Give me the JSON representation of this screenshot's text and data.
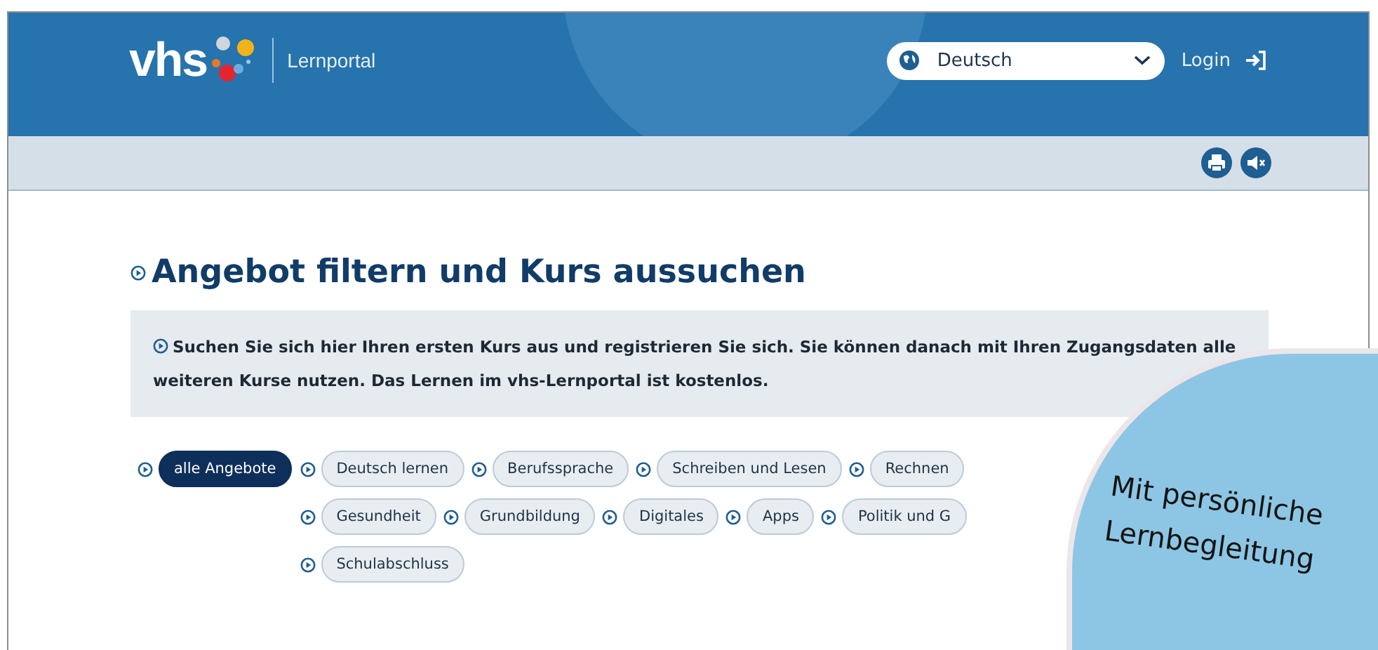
{
  "header": {
    "logo": "vhs",
    "portal_name": "Lernportal",
    "language_select": {
      "value": "Deutsch"
    },
    "login": "Login"
  },
  "heading": "Angebot filtern und Kurs aussuchen",
  "info": "Suchen Sie sich hier Ihren ersten Kurs aus und registrieren Sie sich. Sie können danach mit Ihren Zugangsdaten alle weiteren Kurse nutzen. Das Lernen im vhs-Lernportal ist kostenlos.",
  "filters": [
    {
      "label": "alle Angebote",
      "selected": true
    },
    {
      "label": "Deutsch lernen",
      "selected": false
    },
    {
      "label": "Berufssprache",
      "selected": false
    },
    {
      "label": "Schreiben und Lesen",
      "selected": false
    },
    {
      "label": "Rechnen",
      "selected": false
    },
    {
      "label": "Gesundheit",
      "selected": false
    },
    {
      "label": "Grundbildung",
      "selected": false
    },
    {
      "label": "Digitales",
      "selected": false
    },
    {
      "label": "Apps",
      "selected": false
    },
    {
      "label": "Politik und G",
      "selected": false
    },
    {
      "label": "Schulabschluss",
      "selected": false
    }
  ],
  "sticker": {
    "lines": [
      "Mit persönliche",
      "Lernbegleitung"
    ]
  }
}
